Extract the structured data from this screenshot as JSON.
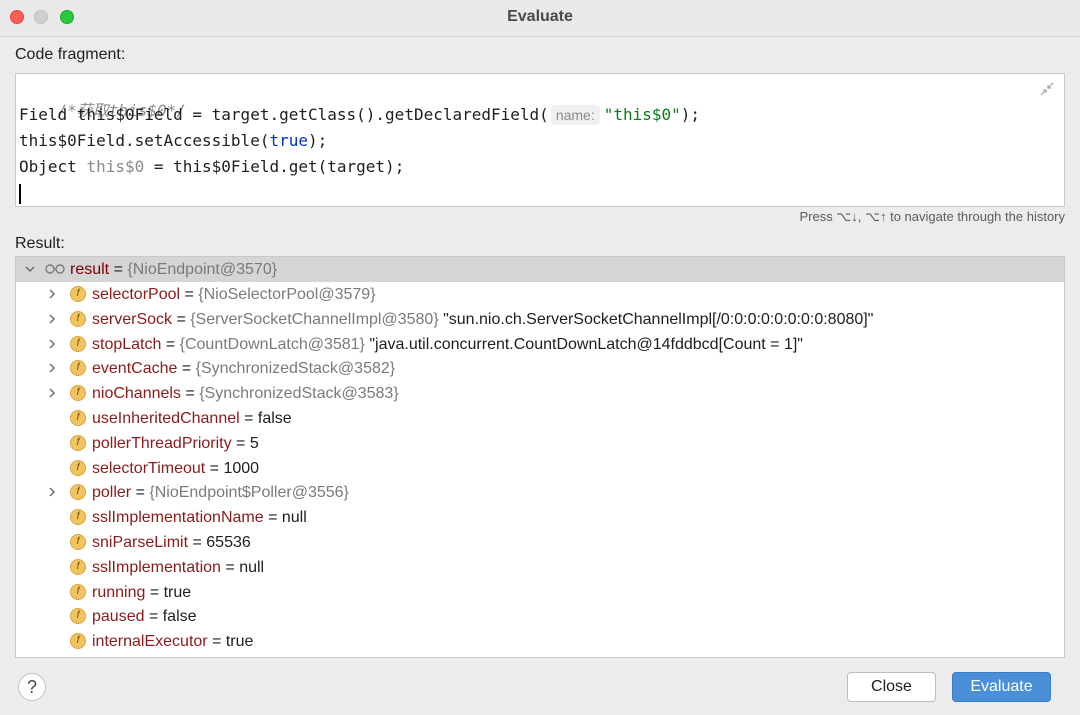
{
  "window": {
    "title": "Evaluate"
  },
  "code_label": "Code fragment:",
  "code": {
    "line1": "/*获取this$0*/",
    "line2_a": "Field this$0Field = target.getClass().getDeclaredField(",
    "line2_hint": "name:",
    "line2_str": "\"this$0\"",
    "line2_end": ");",
    "line3_a": "this$0Field.setAccessible(",
    "line3_kw": "true",
    "line3_end": ");",
    "line4_a": "Object ",
    "line4_var": "this$0",
    "line4_end": " = this$0Field.get(target);"
  },
  "history_hint": "Press ⌥↓, ⌥↑ to navigate through the history",
  "result_label": "Result:",
  "result": {
    "root": {
      "name": "result",
      "eq": " = ",
      "ref": "{NioEndpoint@3570}"
    },
    "rows": [
      {
        "name": "selectorPool",
        "ref": "{NioSelectorPool@3579}",
        "val": ""
      },
      {
        "name": "serverSock",
        "ref": "{ServerSocketChannelImpl@3580}",
        "val": " \"sun.nio.ch.ServerSocketChannelImpl[/0:0:0:0:0:0:0:0:8080]\""
      },
      {
        "name": "stopLatch",
        "ref": "{CountDownLatch@3581}",
        "val": " \"java.util.concurrent.CountDownLatch@14fddbcd[Count = 1]\""
      },
      {
        "name": "eventCache",
        "ref": "{SynchronizedStack@3582}",
        "val": ""
      },
      {
        "name": "nioChannels",
        "ref": "{SynchronizedStack@3583}",
        "val": ""
      },
      {
        "name": "useInheritedChannel",
        "ref": "",
        "val": "false"
      },
      {
        "name": "pollerThreadPriority",
        "ref": "",
        "val": "5"
      },
      {
        "name": "selectorTimeout",
        "ref": "",
        "val": "1000"
      },
      {
        "name": "poller",
        "ref": "{NioEndpoint$Poller@3556}",
        "val": ""
      },
      {
        "name": "sslImplementationName",
        "ref": "",
        "val": "null"
      },
      {
        "name": "sniParseLimit",
        "ref": "",
        "val": "65536"
      },
      {
        "name": "sslImplementation",
        "ref": "",
        "val": "null"
      },
      {
        "name": "running",
        "ref": "",
        "val": "true"
      },
      {
        "name": "paused",
        "ref": "",
        "val": "false"
      },
      {
        "name": "internalExecutor",
        "ref": "",
        "val": "true"
      }
    ],
    "eq": " = ",
    "field_icon_letter": "f"
  },
  "buttons": {
    "help": "?",
    "close": "Close",
    "evaluate": "Evaluate"
  },
  "colors": {
    "accent": "#4a90d9",
    "selection": "#d5d5d5"
  }
}
